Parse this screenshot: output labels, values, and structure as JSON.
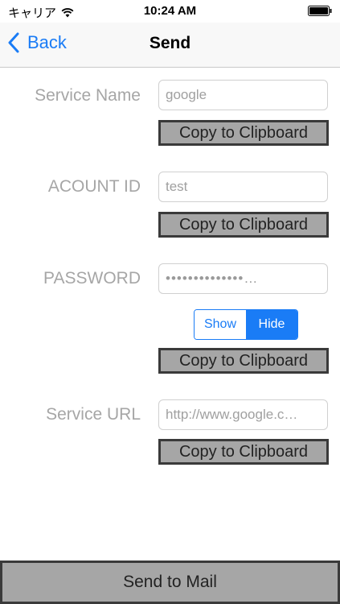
{
  "status_bar": {
    "carrier": "キャリア",
    "time": "10:24 AM",
    "wifi_icon": "wifi-icon",
    "battery_icon": "battery-icon"
  },
  "nav": {
    "back_label": "Back",
    "back_icon": "chevron-left-icon",
    "title": "Send"
  },
  "fields": {
    "service_name": {
      "label": "Service Name",
      "value": "google"
    },
    "account_id": {
      "label": "ACOUNT ID",
      "value": "test"
    },
    "password": {
      "label": "PASSWORD",
      "value": "••••••••••••••…"
    },
    "service_url": {
      "label": "Service URL",
      "value": "http://www.google.c…"
    }
  },
  "copy_label": "Copy to Clipboard",
  "visibility_toggle": {
    "show_label": "Show",
    "hide_label": "Hide",
    "selected": "Hide"
  },
  "send_button_label": "Send to Mail",
  "colors": {
    "accent": "#1a7cf6",
    "button_fill": "#a6a6a6",
    "button_border": "#3a3a3a",
    "label_gray": "#a6a6a6"
  }
}
